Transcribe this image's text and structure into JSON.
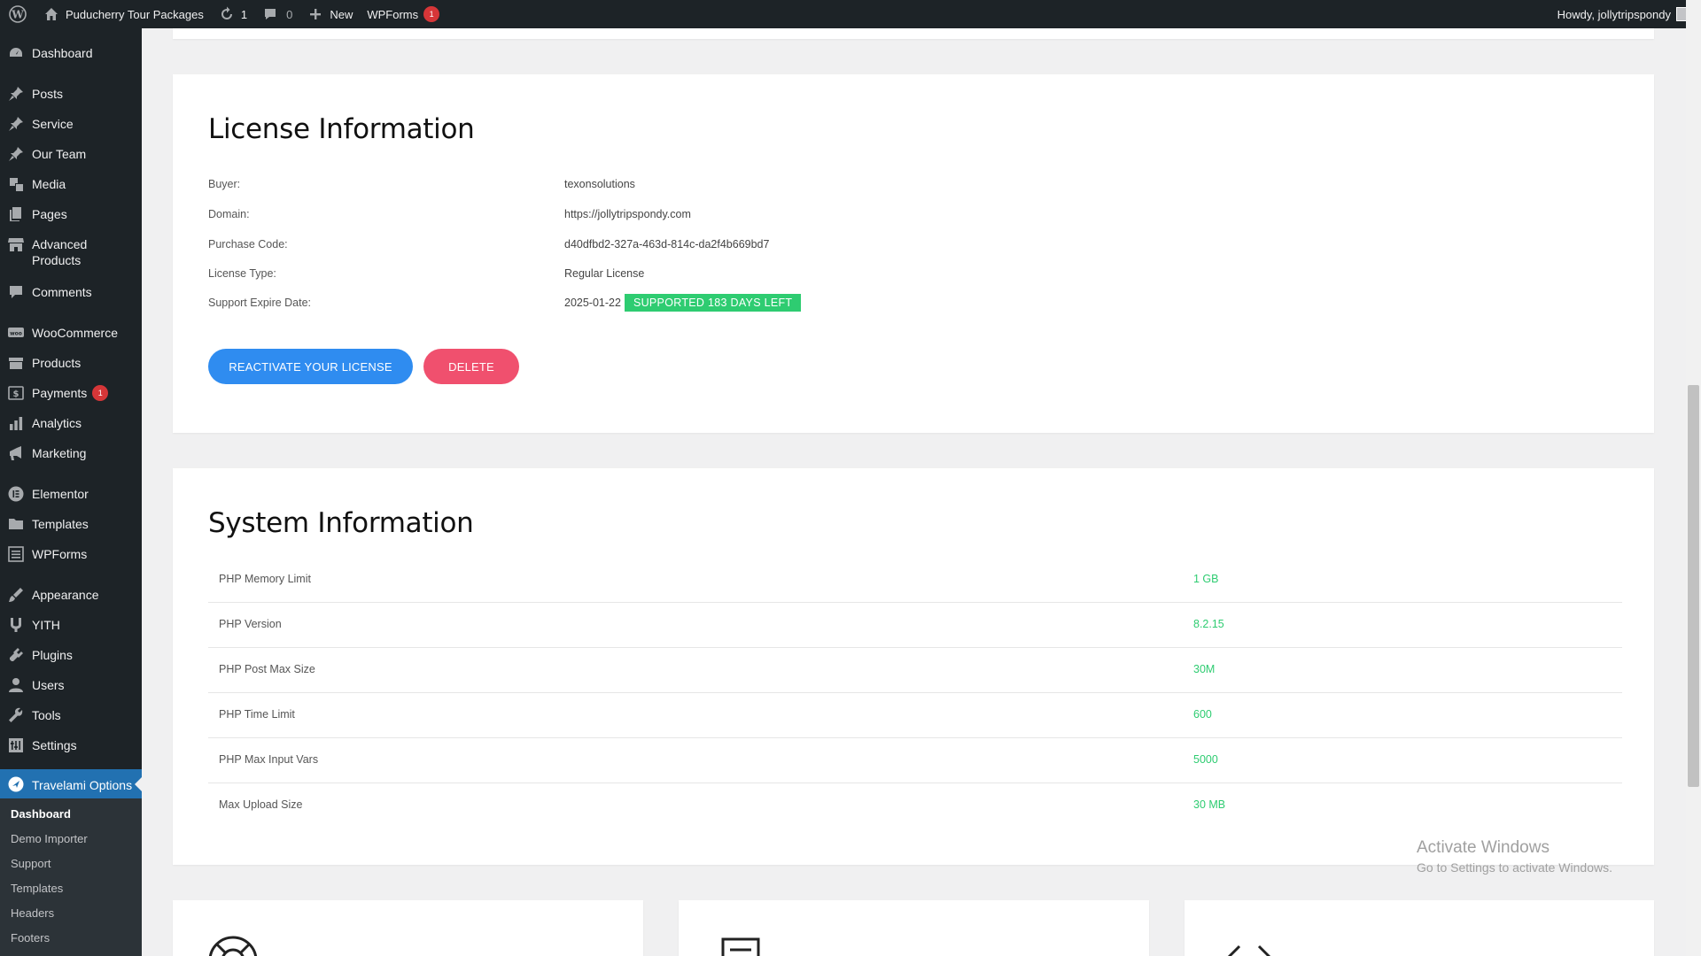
{
  "adminbar": {
    "site_name": "Puducherry Tour Packages",
    "updates_count": "1",
    "comments_count": "0",
    "new_label": "New",
    "wpforms_label": "WPForms",
    "wpforms_badge": "1",
    "howdy": "Howdy, jollytripspondy"
  },
  "sidebar": {
    "items": [
      {
        "label": "Dashboard",
        "icon": "dashboard-icon"
      },
      {
        "label": "Posts",
        "icon": "pin-icon"
      },
      {
        "label": "Service",
        "icon": "pin-icon"
      },
      {
        "label": "Our Team",
        "icon": "pin-icon"
      },
      {
        "label": "Media",
        "icon": "media-icon"
      },
      {
        "label": "Pages",
        "icon": "pages-icon"
      },
      {
        "label": "Advanced Products",
        "icon": "store-icon"
      },
      {
        "label": "Comments",
        "icon": "comment-icon"
      },
      {
        "label": "WooCommerce",
        "icon": "woo-icon"
      },
      {
        "label": "Products",
        "icon": "archive-icon"
      },
      {
        "label": "Payments",
        "icon": "payments-icon",
        "badge": "1"
      },
      {
        "label": "Analytics",
        "icon": "chart-icon"
      },
      {
        "label": "Marketing",
        "icon": "megaphone-icon"
      },
      {
        "label": "Elementor",
        "icon": "elementor-icon"
      },
      {
        "label": "Templates",
        "icon": "folder-icon"
      },
      {
        "label": "WPForms",
        "icon": "forms-icon"
      },
      {
        "label": "Appearance",
        "icon": "brush-icon"
      },
      {
        "label": "YITH",
        "icon": "yith-icon"
      },
      {
        "label": "Plugins",
        "icon": "plugin-icon"
      },
      {
        "label": "Users",
        "icon": "user-icon"
      },
      {
        "label": "Tools",
        "icon": "wrench-icon"
      },
      {
        "label": "Settings",
        "icon": "settings-icon"
      },
      {
        "label": "Travelami Options",
        "icon": "travelami-icon"
      }
    ],
    "submenu": [
      "Dashboard",
      "Demo Importer",
      "Support",
      "Templates",
      "Headers",
      "Footers"
    ]
  },
  "license": {
    "title": "License Information",
    "rows": [
      {
        "label": "Buyer:",
        "value": "texonsolutions"
      },
      {
        "label": "Domain:",
        "value": "https://jollytripspondy.com"
      },
      {
        "label": "Purchase Code:",
        "value": "d40dfbd2-327a-463d-814c-da2f4b669bd7"
      },
      {
        "label": "License Type:",
        "value": "Regular License"
      },
      {
        "label": "Support Expire Date:",
        "value": "2025-01-22",
        "badge": "SUPPORTED 183 DAYS LEFT"
      }
    ],
    "reactivate_label": "REACTIVATE YOUR LICENSE",
    "delete_label": "DELETE"
  },
  "system": {
    "title": "System Information",
    "rows": [
      {
        "label": "PHP Memory Limit",
        "value": "1 GB"
      },
      {
        "label": "PHP Version",
        "value": "8.2.15"
      },
      {
        "label": "PHP Post Max Size",
        "value": "30M"
      },
      {
        "label": "PHP Time Limit",
        "value": "600"
      },
      {
        "label": "PHP Max Input Vars",
        "value": "5000"
      },
      {
        "label": "Max Upload Size",
        "value": "30 MB"
      }
    ]
  },
  "watermark": {
    "line1": "Activate Windows",
    "line2": "Go to Settings to activate Windows."
  },
  "colors": {
    "admin_dark": "#1d2327",
    "accent_blue": "#2271b1",
    "button_blue": "#2f8cf0",
    "button_red": "#f0506e",
    "success_green": "#2ecc71",
    "badge_red": "#d63638"
  }
}
